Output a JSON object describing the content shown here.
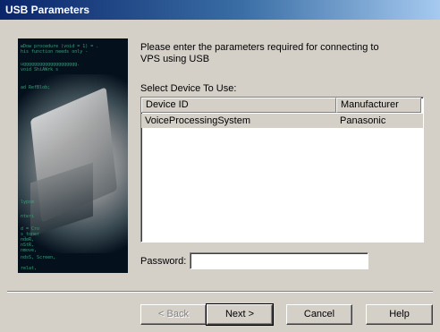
{
  "window": {
    "title": "USB Parameters"
  },
  "intro": {
    "line1": "Please enter the parameters required for connecting to",
    "line2": "VPS using USB"
  },
  "device_list": {
    "label": "Select Device To Use:",
    "columns": [
      "Device ID",
      "Manufacturer"
    ],
    "rows": [
      {
        "device_id": "VoiceProcessingSystem",
        "manufacturer": "Panasonic"
      }
    ],
    "selected_row": 0
  },
  "password": {
    "label": "Password:",
    "value": ""
  },
  "buttons": {
    "back": "< Back",
    "next": "Next >",
    "cancel": "Cancel",
    "help": "Help"
  },
  "colors": {
    "titlebar_start": "#0a246a",
    "titlebar_end": "#a6caf0",
    "dialog_bg": "#d4d0c8"
  }
}
